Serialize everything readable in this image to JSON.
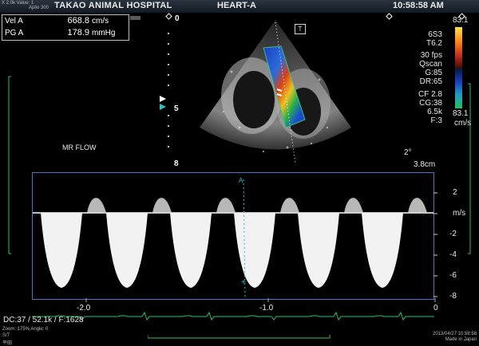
{
  "header": {
    "probe_info": "Aplio 300",
    "hospital": "TAKAO ANIMAL HOSPITAL",
    "mode": "HEART-A",
    "time": "10:58:58 AM",
    "corner_small": "X 2.0k Value: 1"
  },
  "measurements": [
    {
      "label": "Vel  A",
      "value": "668.8",
      "unit": "cm/s"
    },
    {
      "label": "PG  A",
      "value": "178.9",
      "unit": "mmHg"
    }
  ],
  "depth_markers": [
    "0",
    "5",
    "8"
  ],
  "probe_mark": "T",
  "color_scale": {
    "top": "83.1",
    "bottom": "83.1",
    "unit": "cm/s"
  },
  "params": [
    "6S3",
    "T6.2",
    "30 fps",
    "Qscan",
    "G:85",
    "DR:65",
    "CF 2.8",
    "CG:38",
    "6.5k",
    "F:3"
  ],
  "angle": "2°",
  "depth_readout": "3.8cm",
  "mr_label": "MR FLOW",
  "doppler": {
    "scale_labels": [
      "2",
      "m/s",
      "-2",
      "-4",
      "-6",
      "-8"
    ],
    "time_labels": [
      "-2.0",
      "-1.0",
      "0"
    ],
    "baseline_marker": "A"
  },
  "footer": {
    "dc_readout": "DC:37  / 52.1k  / F:1628",
    "bottom_left_1": "Zoom: 175%  Angle: 0",
    "bottom_left_2": "S/7",
    "bottom_left_3": "平田",
    "date": "2013/04/27  10:58:58",
    "made_in": "Made in Japan"
  },
  "colors": {
    "frame_border": "#4a78c8",
    "ecg": "#2fbf5a",
    "sector_outline": "#3ac08a"
  }
}
